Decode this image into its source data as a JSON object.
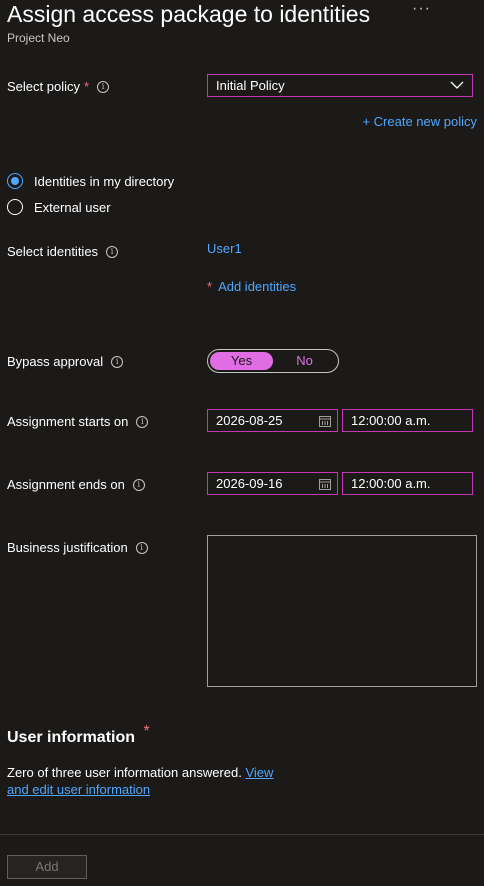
{
  "header": {
    "title": "Assign access package to identities",
    "subtitle": "Project Neo",
    "more": "···"
  },
  "policy": {
    "label": "Select policy",
    "required": "*",
    "value": "Initial Policy",
    "create_link": "+ Create new policy"
  },
  "identity_type": {
    "options": [
      {
        "label": "Identities in my directory",
        "selected": true
      },
      {
        "label": "External user",
        "selected": false
      }
    ]
  },
  "identities": {
    "label": "Select identities",
    "selected_user": "User1",
    "add_required": "*",
    "add_link": "Add identities"
  },
  "bypass": {
    "label": "Bypass approval",
    "yes": "Yes",
    "no": "No",
    "value": "Yes"
  },
  "starts": {
    "label": "Assignment starts on",
    "date": "2026-08-25",
    "time": "12:00:00 a.m."
  },
  "ends": {
    "label": "Assignment ends on",
    "date": "2026-09-16",
    "time": "12:00:00 a.m."
  },
  "justification": {
    "label": "Business justification",
    "value": ""
  },
  "user_info": {
    "title": "User information",
    "required": "*",
    "text": "Zero of three user information answered.",
    "link": "View and edit user information"
  },
  "footer": {
    "add_label": "Add"
  },
  "colors": {
    "accent": "#c239b3",
    "toggle_on": "#e16de4",
    "link": "#4fa7ff",
    "required": "#f1707b",
    "background": "#1b1a19"
  }
}
